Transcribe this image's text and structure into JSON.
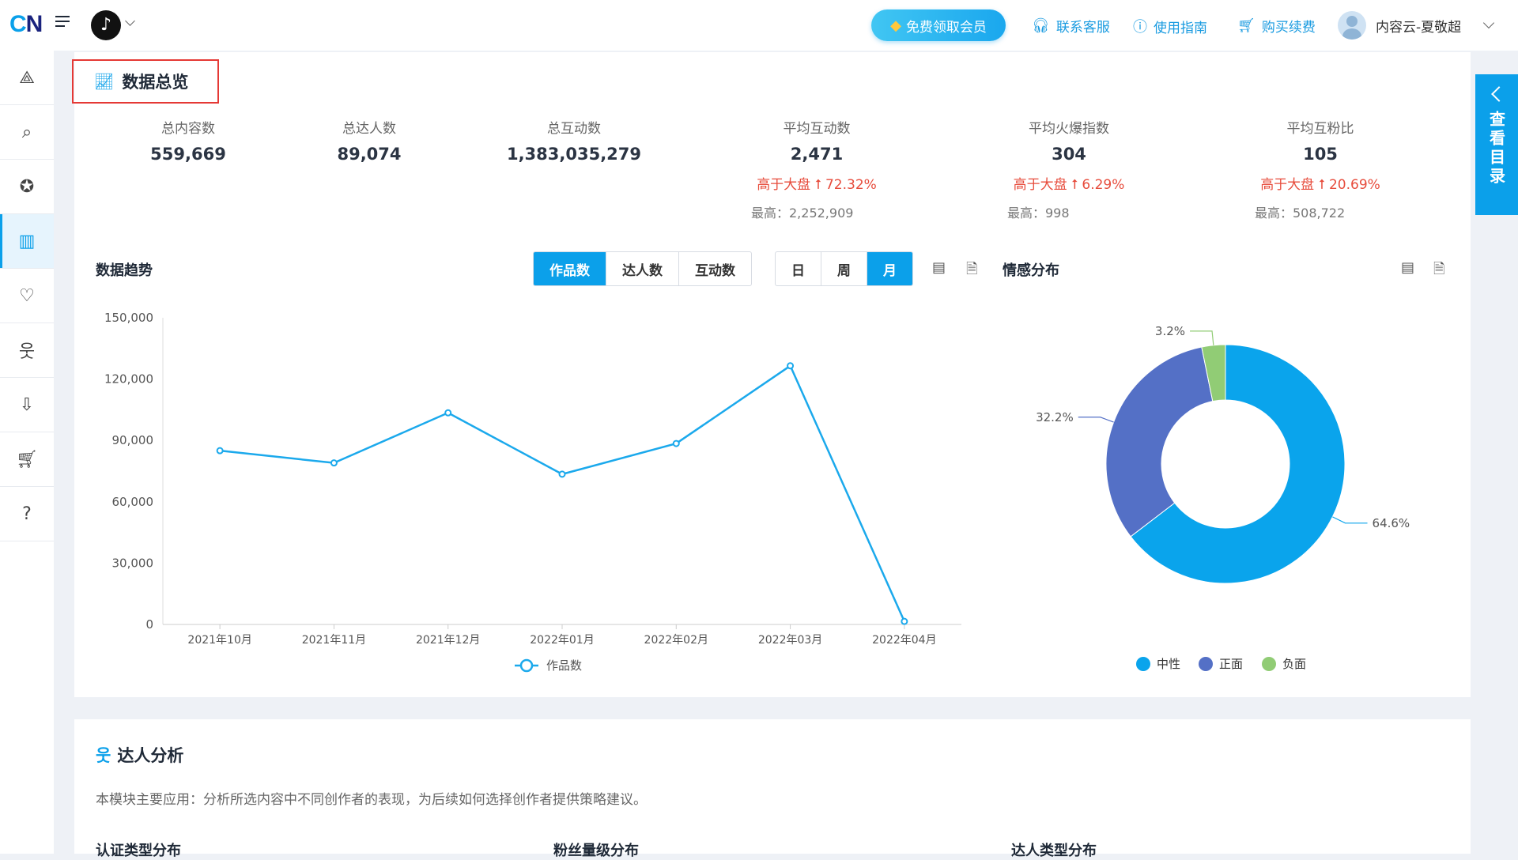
{
  "brand": {
    "logo": "CN",
    "platform_icon": "tiktok-icon"
  },
  "topbar": {
    "vip_label": "免费领取会员",
    "links": [
      {
        "label": "联系客服",
        "icon": "headset-icon"
      },
      {
        "label": "使用指南",
        "icon": "help-circle-icon"
      },
      {
        "label": "购买续费",
        "icon": "cart-icon"
      }
    ],
    "user_name": "内容云-夏敬超"
  },
  "sidebar": {
    "items": [
      {
        "icon": "network-icon"
      },
      {
        "icon": "search-analysis-icon"
      },
      {
        "icon": "medal-icon"
      },
      {
        "icon": "bar-chart-icon",
        "active": true
      },
      {
        "icon": "heartbeat-icon"
      },
      {
        "icon": "person-icon"
      },
      {
        "icon": "download-doc-icon"
      },
      {
        "icon": "cart-icon"
      },
      {
        "icon": "help-icon"
      }
    ]
  },
  "overview": {
    "title": "数据总览",
    "stats": [
      {
        "label": "总内容数",
        "value": "559,669"
      },
      {
        "label": "总达人数",
        "value": "89,074"
      },
      {
        "label": "总互动数",
        "value": "1,383,035,279"
      },
      {
        "label": "平均互动数",
        "value": "2,471",
        "compare": "高于大盘 ⭡ 72.32%",
        "max": "最高：2,252,909"
      },
      {
        "label": "平均火爆指数",
        "value": "304",
        "compare": "高于大盘 ⭡ 6.29%",
        "max": "最高：998"
      },
      {
        "label": "平均互粉比",
        "value": "105",
        "compare": "高于大盘 ⭡ 20.69%",
        "max": "最高：508,722"
      }
    ]
  },
  "trend": {
    "title": "数据趋势",
    "metric_tabs": [
      "作品数",
      "达人数",
      "互动数"
    ],
    "metric_selected": "作品数",
    "period_tabs": [
      "日",
      "周",
      "月"
    ],
    "period_selected": "月"
  },
  "sentiment": {
    "title": "情感分布",
    "legend": [
      "中性",
      "正面",
      "负面"
    ]
  },
  "colors": {
    "accent": "#0ba0ea",
    "line": "#1ba9ec",
    "neutral": "#0aa4ec",
    "positive": "#5470c6",
    "negative": "#91cc75",
    "up": "#e74c3c"
  },
  "chart_data": [
    {
      "type": "line",
      "x": [
        "2021年10月",
        "2021年11月",
        "2021年12月",
        "2022年01月",
        "2022年02月",
        "2022年03月",
        "2022年04月"
      ],
      "series": [
        {
          "name": "作品数",
          "values": [
            85000,
            79000,
            103500,
            73500,
            88500,
            126500,
            1500
          ]
        }
      ],
      "ylim": [
        0,
        150000
      ],
      "yticks": [
        "0",
        "30,000",
        "60,000",
        "90,000",
        "120,000",
        "150,000"
      ],
      "grid": false,
      "legend": "bottom"
    },
    {
      "type": "pie",
      "labels": [
        "中性",
        "正面",
        "负面"
      ],
      "values": [
        64.6,
        32.2,
        3.2
      ],
      "value_labels": [
        "64.6%",
        "32.2%",
        "3.2%"
      ],
      "donut": true,
      "legend": "bottom"
    }
  ],
  "talent": {
    "title": "达人分析",
    "description": "本模块主要应用：分析所选内容中不同创作者的表现，为后续如何选择创作者提供策略建议。",
    "sub_titles": [
      "认证类型分布",
      "粉丝量级分布",
      "达人类型分布"
    ]
  },
  "side_tab_label": "查看目录"
}
